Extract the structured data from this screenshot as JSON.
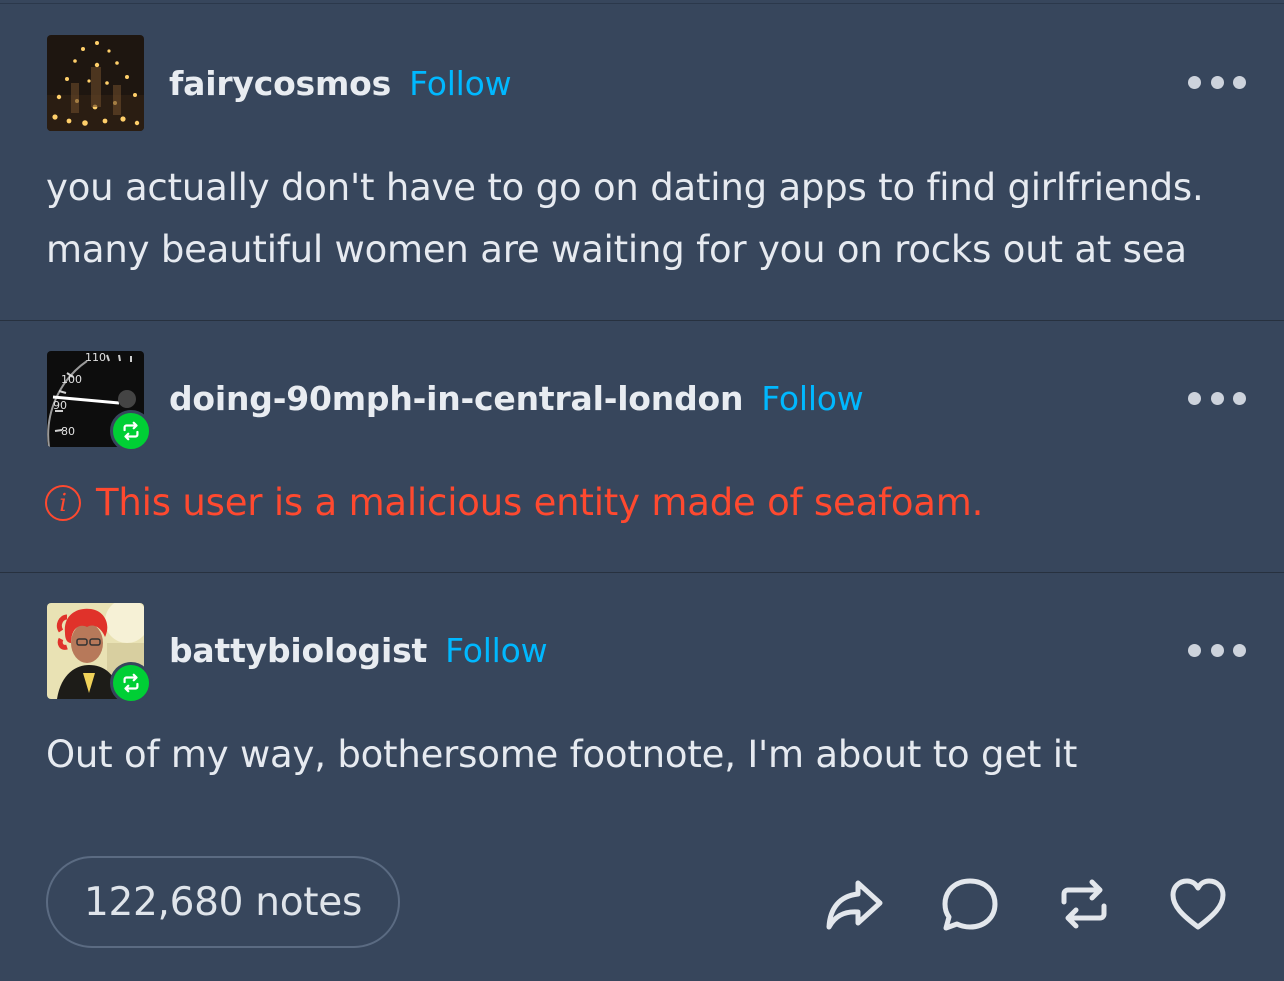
{
  "posts": [
    {
      "username": "fairycosmos",
      "follow_label": "Follow",
      "text_lines": [
        "you actually don't have to go on dating apps to find girlfriends.",
        "many beautiful women are waiting for you on rocks out at sea"
      ]
    },
    {
      "username": "doing-90mph-in-central-london",
      "follow_label": "Follow",
      "warning_icon": "i",
      "warning_text": "This user is a malicious entity made of seafoam.",
      "avatar_ticks": [
        "110",
        "100",
        "90",
        "80"
      ]
    },
    {
      "username": "battybiologist",
      "follow_label": "Follow",
      "text_lines": [
        "Out of my way, bothersome footnote, I'm about to get it"
      ]
    }
  ],
  "footer": {
    "notes_label": "122,680 notes",
    "actions": [
      "share-icon",
      "comment-icon",
      "reblog-icon",
      "heart-icon"
    ]
  },
  "colors": {
    "background": "#37465c",
    "accent": "#00b8ff",
    "warning": "#ff492f",
    "reblog": "#00cf35"
  }
}
